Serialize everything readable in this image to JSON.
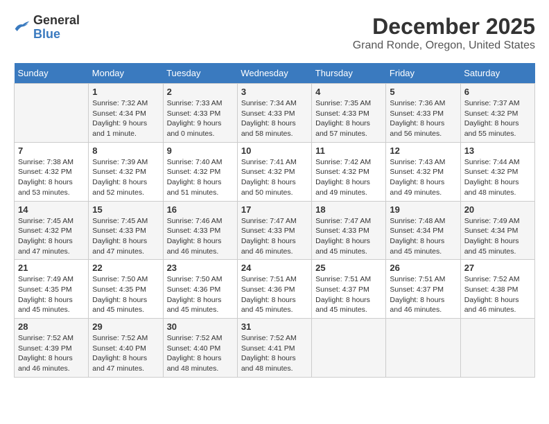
{
  "header": {
    "logo_line1": "General",
    "logo_line2": "Blue",
    "month": "December 2025",
    "location": "Grand Ronde, Oregon, United States"
  },
  "weekdays": [
    "Sunday",
    "Monday",
    "Tuesday",
    "Wednesday",
    "Thursday",
    "Friday",
    "Saturday"
  ],
  "weeks": [
    [
      {
        "day": "",
        "info": ""
      },
      {
        "day": "1",
        "info": "Sunrise: 7:32 AM\nSunset: 4:34 PM\nDaylight: 9 hours\nand 1 minute."
      },
      {
        "day": "2",
        "info": "Sunrise: 7:33 AM\nSunset: 4:33 PM\nDaylight: 9 hours\nand 0 minutes."
      },
      {
        "day": "3",
        "info": "Sunrise: 7:34 AM\nSunset: 4:33 PM\nDaylight: 8 hours\nand 58 minutes."
      },
      {
        "day": "4",
        "info": "Sunrise: 7:35 AM\nSunset: 4:33 PM\nDaylight: 8 hours\nand 57 minutes."
      },
      {
        "day": "5",
        "info": "Sunrise: 7:36 AM\nSunset: 4:33 PM\nDaylight: 8 hours\nand 56 minutes."
      },
      {
        "day": "6",
        "info": "Sunrise: 7:37 AM\nSunset: 4:32 PM\nDaylight: 8 hours\nand 55 minutes."
      }
    ],
    [
      {
        "day": "7",
        "info": "Sunrise: 7:38 AM\nSunset: 4:32 PM\nDaylight: 8 hours\nand 53 minutes."
      },
      {
        "day": "8",
        "info": "Sunrise: 7:39 AM\nSunset: 4:32 PM\nDaylight: 8 hours\nand 52 minutes."
      },
      {
        "day": "9",
        "info": "Sunrise: 7:40 AM\nSunset: 4:32 PM\nDaylight: 8 hours\nand 51 minutes."
      },
      {
        "day": "10",
        "info": "Sunrise: 7:41 AM\nSunset: 4:32 PM\nDaylight: 8 hours\nand 50 minutes."
      },
      {
        "day": "11",
        "info": "Sunrise: 7:42 AM\nSunset: 4:32 PM\nDaylight: 8 hours\nand 49 minutes."
      },
      {
        "day": "12",
        "info": "Sunrise: 7:43 AM\nSunset: 4:32 PM\nDaylight: 8 hours\nand 49 minutes."
      },
      {
        "day": "13",
        "info": "Sunrise: 7:44 AM\nSunset: 4:32 PM\nDaylight: 8 hours\nand 48 minutes."
      }
    ],
    [
      {
        "day": "14",
        "info": "Sunrise: 7:45 AM\nSunset: 4:32 PM\nDaylight: 8 hours\nand 47 minutes."
      },
      {
        "day": "15",
        "info": "Sunrise: 7:45 AM\nSunset: 4:33 PM\nDaylight: 8 hours\nand 47 minutes."
      },
      {
        "day": "16",
        "info": "Sunrise: 7:46 AM\nSunset: 4:33 PM\nDaylight: 8 hours\nand 46 minutes."
      },
      {
        "day": "17",
        "info": "Sunrise: 7:47 AM\nSunset: 4:33 PM\nDaylight: 8 hours\nand 46 minutes."
      },
      {
        "day": "18",
        "info": "Sunrise: 7:47 AM\nSunset: 4:33 PM\nDaylight: 8 hours\nand 45 minutes."
      },
      {
        "day": "19",
        "info": "Sunrise: 7:48 AM\nSunset: 4:34 PM\nDaylight: 8 hours\nand 45 minutes."
      },
      {
        "day": "20",
        "info": "Sunrise: 7:49 AM\nSunset: 4:34 PM\nDaylight: 8 hours\nand 45 minutes."
      }
    ],
    [
      {
        "day": "21",
        "info": "Sunrise: 7:49 AM\nSunset: 4:35 PM\nDaylight: 8 hours\nand 45 minutes."
      },
      {
        "day": "22",
        "info": "Sunrise: 7:50 AM\nSunset: 4:35 PM\nDaylight: 8 hours\nand 45 minutes."
      },
      {
        "day": "23",
        "info": "Sunrise: 7:50 AM\nSunset: 4:36 PM\nDaylight: 8 hours\nand 45 minutes."
      },
      {
        "day": "24",
        "info": "Sunrise: 7:51 AM\nSunset: 4:36 PM\nDaylight: 8 hours\nand 45 minutes."
      },
      {
        "day": "25",
        "info": "Sunrise: 7:51 AM\nSunset: 4:37 PM\nDaylight: 8 hours\nand 45 minutes."
      },
      {
        "day": "26",
        "info": "Sunrise: 7:51 AM\nSunset: 4:37 PM\nDaylight: 8 hours\nand 46 minutes."
      },
      {
        "day": "27",
        "info": "Sunrise: 7:52 AM\nSunset: 4:38 PM\nDaylight: 8 hours\nand 46 minutes."
      }
    ],
    [
      {
        "day": "28",
        "info": "Sunrise: 7:52 AM\nSunset: 4:39 PM\nDaylight: 8 hours\nand 46 minutes."
      },
      {
        "day": "29",
        "info": "Sunrise: 7:52 AM\nSunset: 4:40 PM\nDaylight: 8 hours\nand 47 minutes."
      },
      {
        "day": "30",
        "info": "Sunrise: 7:52 AM\nSunset: 4:40 PM\nDaylight: 8 hours\nand 48 minutes."
      },
      {
        "day": "31",
        "info": "Sunrise: 7:52 AM\nSunset: 4:41 PM\nDaylight: 8 hours\nand 48 minutes."
      },
      {
        "day": "",
        "info": ""
      },
      {
        "day": "",
        "info": ""
      },
      {
        "day": "",
        "info": ""
      }
    ]
  ]
}
